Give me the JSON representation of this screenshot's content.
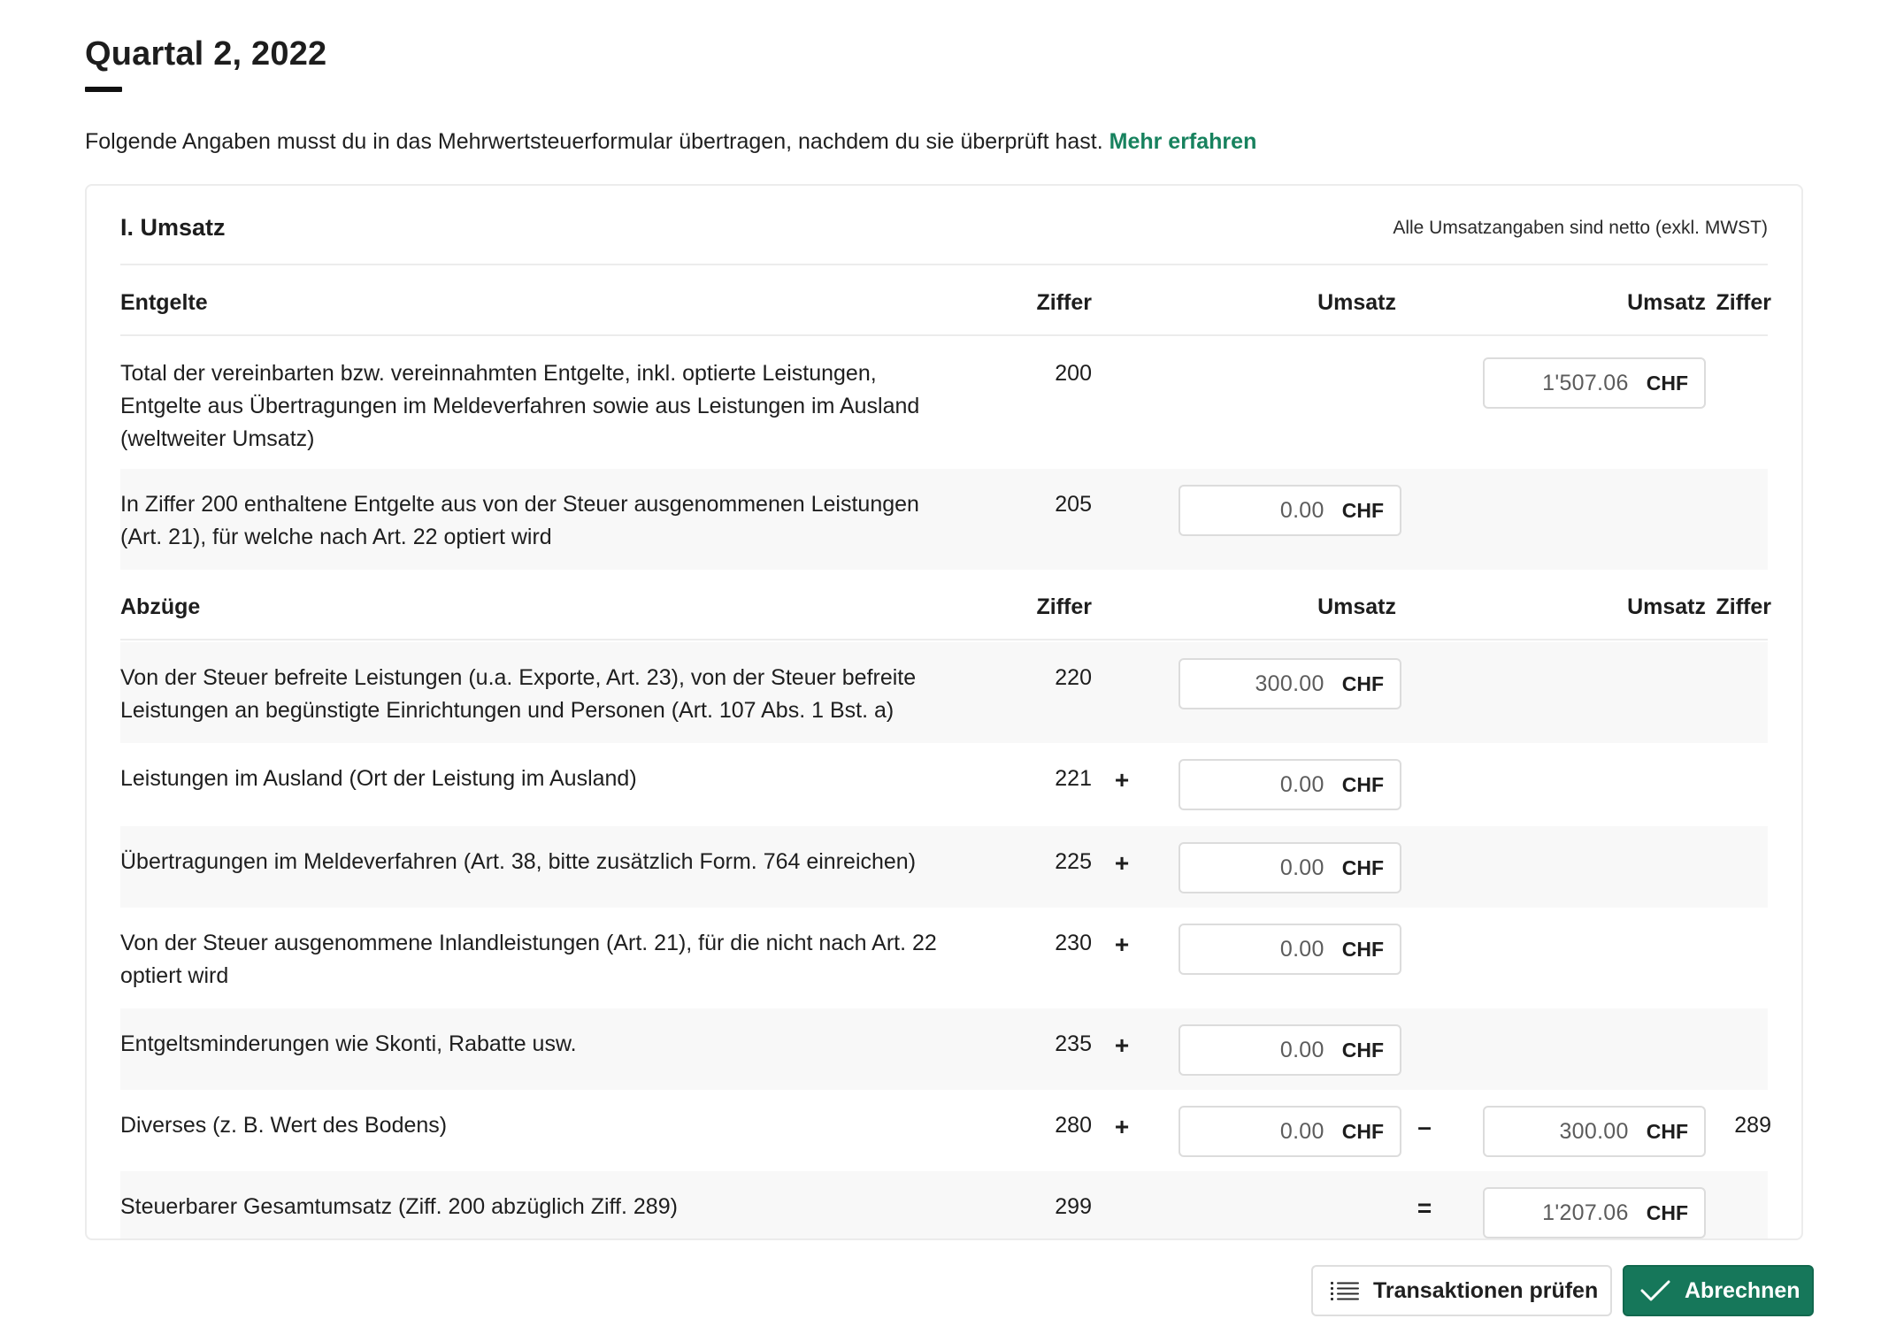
{
  "header": {
    "title": "Quartal 2, 2022",
    "intro_text": "Folgende Angaben musst du in das Mehrwertsteuerformular übertragen, nachdem du sie überprüft hast.",
    "intro_link": "Mehr erfahren"
  },
  "section": {
    "title": "I. Umsatz",
    "note": "Alle Umsatzangaben sind netto (exkl. MWST)"
  },
  "columns": {
    "entgelte": "Entgelte",
    "abzuege": "Abzüge",
    "ziffer": "Ziffer",
    "umsatz": "Umsatz"
  },
  "currency": "CHF",
  "rows": [
    {
      "label": "Total der vereinbarten bzw. vereinnahmten Entgelte, inkl. optierte Leistungen, Entgelte aus Übertragungen im Meldeverfahren sowie aus Leistungen im Ausland (weltweiter Umsatz)",
      "code": "200",
      "right_value": "1'507.06"
    },
    {
      "label": "In Ziffer 200 enthaltene Entgelte aus von der Steuer ausgenommenen Leistungen (Art. 21), für welche nach Art. 22 optiert wird",
      "code": "205",
      "value": "0.00"
    },
    {
      "label": "Von der Steuer befreite Leistungen (u.a. Exporte, Art. 23), von der Steuer befreite Leistungen an begünstigte Einrichtungen und Personen (Art. 107 Abs. 1 Bst. a)",
      "code": "220",
      "value": "300.00"
    },
    {
      "label": "Leistungen im Ausland (Ort der Leistung im Ausland)",
      "code": "221",
      "op": "+",
      "value": "0.00"
    },
    {
      "label": "Übertragungen im Meldeverfahren (Art. 38, bitte zusätzlich Form. 764 einreichen)",
      "code": "225",
      "op": "+",
      "value": "0.00"
    },
    {
      "label": "Von der Steuer ausgenommene Inlandleistungen (Art. 21), für die nicht nach Art. 22 optiert wird",
      "code": "230",
      "op": "+",
      "value": "0.00"
    },
    {
      "label": "Entgeltsminderungen wie Skonti, Rabatte usw.",
      "code": "235",
      "op": "+",
      "value": "0.00"
    },
    {
      "label": "Diverses (z. B. Wert des Bodens)",
      "code": "280",
      "op": "+",
      "value": "0.00",
      "op2": "–",
      "right_value": "300.00",
      "code2": "289"
    },
    {
      "label": "Steuerbarer Gesamtumsatz (Ziff. 200 abzüglich Ziff. 289)",
      "code": "299",
      "op2": "=",
      "right_value": "1'207.06"
    }
  ],
  "buttons": {
    "review": "Transaktionen prüfen",
    "submit": "Abrechnen"
  },
  "icons": {
    "review": "list-icon",
    "submit": "check-icon"
  },
  "colors": {
    "accent": "#16775a",
    "link": "#17825e"
  }
}
